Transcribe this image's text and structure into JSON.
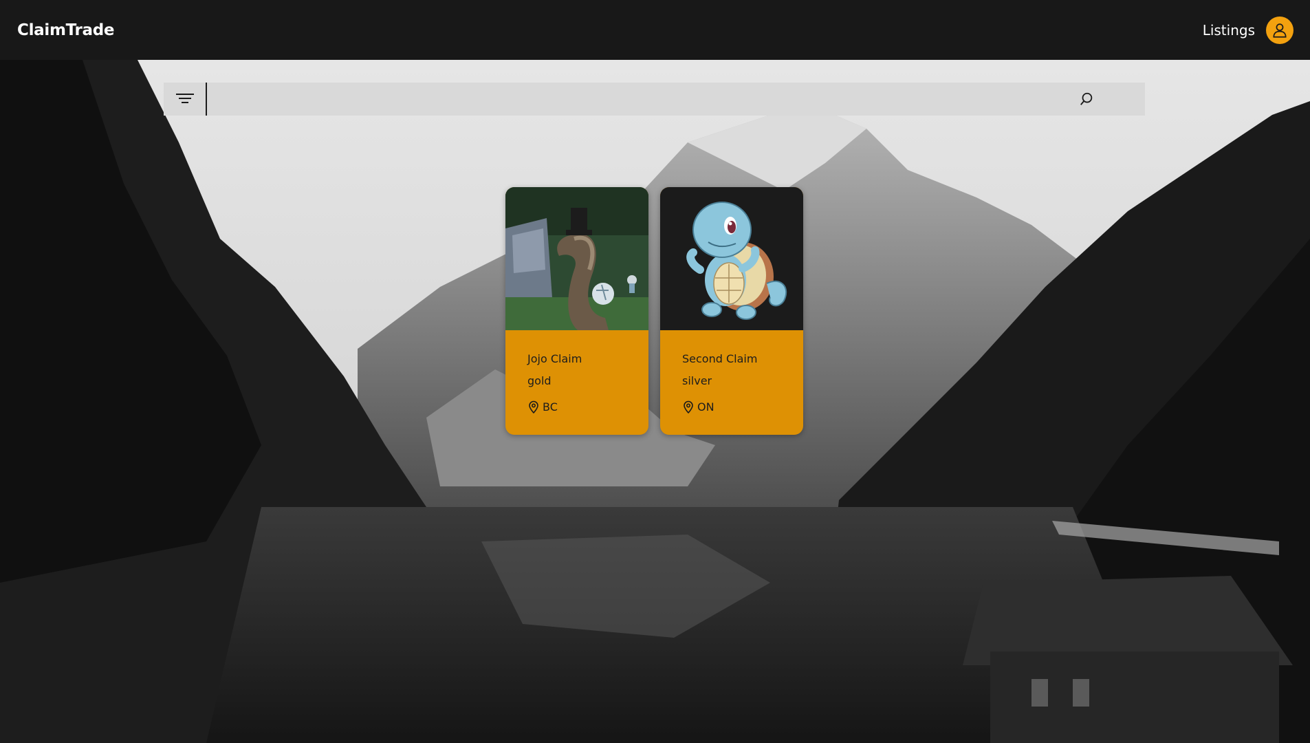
{
  "app": {
    "brand": "ClaimTrade",
    "nav": {
      "listings_label": "Listings"
    }
  },
  "search": {
    "placeholder": "",
    "value": ""
  },
  "icons": {
    "filter": "filter-icon",
    "search": "search-icon",
    "user": "user-icon",
    "location": "location-pin-icon"
  },
  "colors": {
    "accent": "#f3a10f",
    "card": "#de9104",
    "topbar": "#181818",
    "searchbar": "#d9d9d9"
  },
  "listings": [
    {
      "title": "Jojo Claim",
      "tier": "gold",
      "region": "BC",
      "image": "worm-character-image"
    },
    {
      "title": "Second Claim",
      "tier": "silver",
      "region": "ON",
      "image": "squirtle-image"
    }
  ]
}
